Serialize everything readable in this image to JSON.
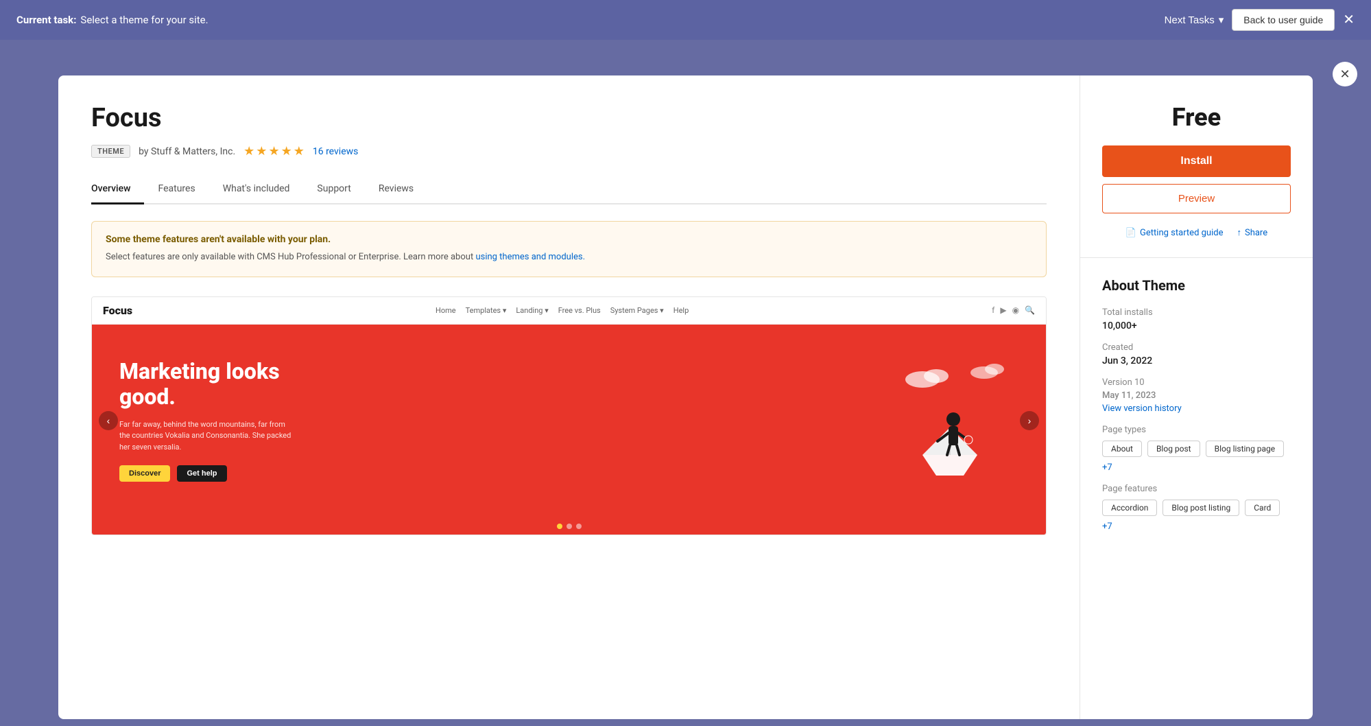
{
  "taskbar": {
    "current_task_label": "Current task:",
    "current_task_text": "Select a theme for your site.",
    "next_tasks_label": "Next Tasks",
    "back_to_guide_label": "Back to user guide"
  },
  "modal": {
    "theme_name": "Focus",
    "theme_badge": "THEME",
    "theme_author": "by Stuff & Matters, Inc.",
    "star_count": 5,
    "reviews_count": "16 reviews",
    "tabs": [
      {
        "id": "overview",
        "label": "Overview",
        "active": true
      },
      {
        "id": "features",
        "label": "Features",
        "active": false
      },
      {
        "id": "whats-included",
        "label": "What's included",
        "active": false
      },
      {
        "id": "support",
        "label": "Support",
        "active": false
      },
      {
        "id": "reviews",
        "label": "Reviews",
        "active": false
      }
    ],
    "warning": {
      "title": "Some theme features aren't available with your plan.",
      "body": "Select features are only available with CMS Hub Professional or Enterprise. Learn more about",
      "link_text": "using themes and modules.",
      "link_url": "#"
    },
    "preview": {
      "logo": "Focus",
      "nav_links": [
        "Home",
        "Templates",
        "Landing",
        "Free vs. Plus",
        "System Pages",
        "Help"
      ],
      "hero": {
        "title": "Marketing looks good.",
        "subtitle": "Far far away, behind the word mountains, far from the countries Vokalia and Consonantia. She packed her seven versalia.",
        "btn1": "Discover",
        "btn2": "Get help"
      },
      "carousel_dots": [
        {
          "active": true
        },
        {
          "active": false
        },
        {
          "active": false
        }
      ]
    },
    "pricing": {
      "price": "Free",
      "install_label": "Install",
      "preview_label": "Preview",
      "getting_started_label": "Getting started guide",
      "share_label": "Share"
    },
    "about": {
      "title": "About Theme",
      "total_installs_label": "Total installs",
      "total_installs_value": "10,000+",
      "created_label": "Created",
      "created_value": "Jun 3, 2022",
      "version_label": "Version 10",
      "version_date": "May 11, 2023",
      "version_history_link": "View version history",
      "page_types_label": "Page types",
      "page_types": [
        "About",
        "Blog post",
        "Blog listing page"
      ],
      "page_types_more": "+7",
      "page_features_label": "Page features",
      "page_features": [
        "Accordion",
        "Blog post listing",
        "Card"
      ],
      "page_features_more": "+7"
    }
  }
}
